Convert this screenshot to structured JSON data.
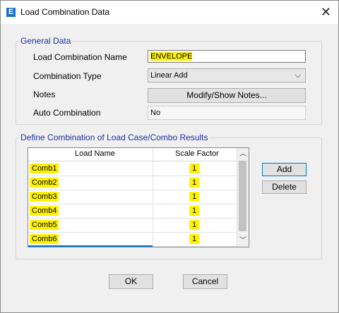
{
  "window": {
    "title": "Load Combination Data",
    "app_icon_letter": "E"
  },
  "general": {
    "legend": "General Data",
    "name_label": "Load Combination Name",
    "name_value": "ENVELOPE",
    "type_label": "Combination Type",
    "type_value": "Linear Add",
    "notes_label": "Notes",
    "notes_button": "Modify/Show Notes...",
    "auto_label": "Auto Combination",
    "auto_value": "No"
  },
  "define": {
    "legend": "Define Combination of Load Case/Combo Results",
    "col_name": "Load Name",
    "col_scale": "Scale Factor",
    "rows": [
      {
        "name": "Comb1",
        "scale": "1"
      },
      {
        "name": "Comb2",
        "scale": "1"
      },
      {
        "name": "Comb3",
        "scale": "1"
      },
      {
        "name": "Comb4",
        "scale": "1"
      },
      {
        "name": "Comb5",
        "scale": "1"
      },
      {
        "name": "Comb6",
        "scale": "1"
      }
    ],
    "add_button": "Add",
    "delete_button": "Delete"
  },
  "footer": {
    "ok_button": "OK",
    "cancel_button": "Cancel"
  },
  "colors": {
    "accent": "#0078d7",
    "highlight": "#fff200",
    "legend": "#1f2f9c"
  },
  "icons": {
    "close": "close-icon",
    "dropdown": "chevron-down-icon",
    "scroll_up": "chevron-up-icon",
    "scroll_down": "chevron-down-icon"
  }
}
